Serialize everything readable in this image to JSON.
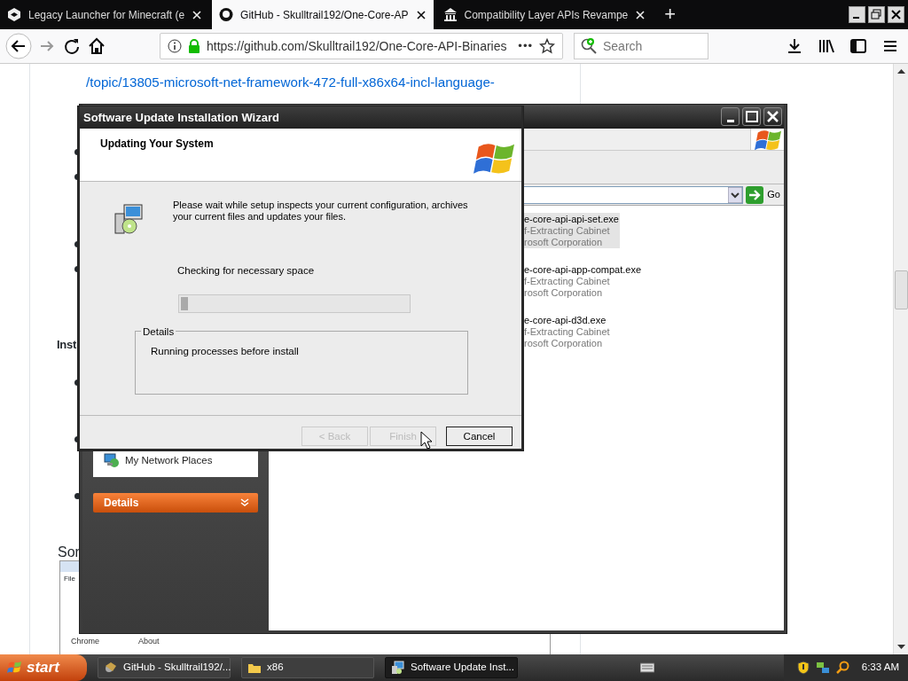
{
  "browser": {
    "tabs": [
      {
        "title": "Legacy Launcher for Minecraft (e",
        "selected": false
      },
      {
        "title": "GitHub - Skulltrail192/One-Core-AP",
        "selected": true
      },
      {
        "title": "Compatibility Layer APIs Revampe",
        "selected": false
      }
    ],
    "new_tab": "+",
    "url": "https://github.com/Skulltrail192/One-Core-API-Binaries",
    "page_actions": "•••",
    "search": {
      "placeholder": "Search"
    }
  },
  "page": {
    "link_line": "/topic/13805-microsoft-net-framework-472-full-x86x64-incl-language-",
    "heading_fragment": "Inst",
    "text_fragment": "Sor",
    "embedded_screenshot": {
      "menu": "File",
      "labels": [
        "Chrome",
        "About"
      ]
    }
  },
  "explorer": {
    "go": "Go",
    "sidebar": [
      {
        "label": "My Network Places",
        "kind": "link"
      },
      {
        "label": "Details",
        "kind": "header"
      }
    ],
    "files": [
      {
        "name": "e-core-api-api-set.exe",
        "type": "f-Extracting Cabinet",
        "company": "rosoft Corporation",
        "selected": true
      },
      {
        "name": "e-core-api-app-compat.exe",
        "type": "f-Extracting Cabinet",
        "company": "rosoft Corporation",
        "selected": false
      },
      {
        "name": "e-core-api-d3d.exe",
        "type": "f-Extracting Cabinet",
        "company": "rosoft Corporation",
        "selected": false
      }
    ]
  },
  "wizard": {
    "title": "Software Update Installation Wizard",
    "header": "Updating Your System",
    "message": "Please wait while setup inspects your current configuration, archives your current files and updates your files.",
    "status": "Checking for necessary space",
    "progress": {
      "level": 0.03
    },
    "details_label": "Details",
    "details_text": "Running processes before install",
    "buttons": [
      {
        "label": "< Back",
        "disabled": true
      },
      {
        "label": "Finish",
        "disabled": true
      },
      {
        "label": "Cancel",
        "disabled": false
      }
    ]
  },
  "taskbar": {
    "start": "start",
    "tasks": [
      {
        "label": "GitHub - Skulltrail192/...",
        "selected": false
      },
      {
        "label": "x86",
        "selected": false
      },
      {
        "label": "Software Update Inst...",
        "selected": true
      }
    ],
    "clock": "6:33 AM"
  }
}
